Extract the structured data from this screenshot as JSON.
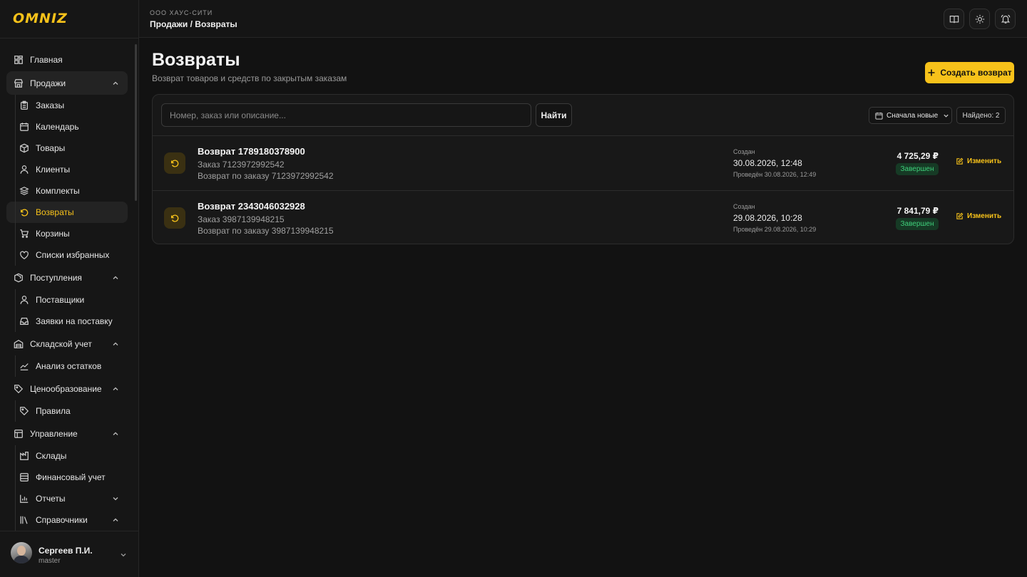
{
  "app": {
    "logo": "OMNIZ"
  },
  "header": {
    "org": "ООО ХАУС-СИТИ",
    "breadcrumb": "Продажи / Возвраты"
  },
  "sidebar": {
    "items": [
      {
        "label": "Главная",
        "icon": "dashboard-icon"
      },
      {
        "label": "Продажи",
        "icon": "store-icon",
        "expanded": true
      },
      {
        "label": "Заказы",
        "icon": "clipboard-icon"
      },
      {
        "label": "Календарь",
        "icon": "calendar-icon"
      },
      {
        "label": "Товары",
        "icon": "box-icon"
      },
      {
        "label": "Клиенты",
        "icon": "user-icon"
      },
      {
        "label": "Комплекты",
        "icon": "layers-icon"
      },
      {
        "label": "Возвраты",
        "icon": "return-icon",
        "active": true
      },
      {
        "label": "Корзины",
        "icon": "cart-icon"
      },
      {
        "label": "Списки избранных",
        "icon": "heart-icon"
      },
      {
        "label": "Поступления",
        "icon": "package-icon",
        "expanded": true
      },
      {
        "label": "Поставщики",
        "icon": "user-icon"
      },
      {
        "label": "Заявки на поставку",
        "icon": "inbox-icon"
      },
      {
        "label": "Складской учет",
        "icon": "warehouse-icon",
        "expanded": true
      },
      {
        "label": "Анализ остатков",
        "icon": "chart-icon"
      },
      {
        "label": "Ценообразование",
        "icon": "tag-icon",
        "expanded": true
      },
      {
        "label": "Правила",
        "icon": "tag-icon"
      },
      {
        "label": "Управление",
        "icon": "layout-icon",
        "expanded": true
      },
      {
        "label": "Склады",
        "icon": "warehouse-icon"
      },
      {
        "label": "Финансовый учет",
        "icon": "finance-icon"
      },
      {
        "label": "Отчеты",
        "icon": "bar-chart-icon",
        "expanded": false
      },
      {
        "label": "Справочники",
        "icon": "library-icon",
        "expanded": true
      }
    ]
  },
  "user": {
    "name": "Сергеев П.И.",
    "role": "master"
  },
  "page": {
    "title": "Возвраты",
    "subtitle": "Возврат товаров и средств по закрытым заказам",
    "create_label": "Создать возврат"
  },
  "search": {
    "placeholder": "Номер, заказ или описание...",
    "value": "",
    "button": "Найти"
  },
  "sort": {
    "selected": "Сначала новые"
  },
  "found_label": "Найдено: 2",
  "returns": [
    {
      "title": "Возврат 1789180378900",
      "order": "Заказ 7123972992542",
      "description": "Возврат по заказу 7123972992542",
      "created_label": "Создан",
      "created": "30.08.2026, 12:48",
      "posted": "Проведён 30.08.2026, 12:49",
      "amount": "4 725,29 ₽",
      "status": "Завершен",
      "edit_label": "Изменить"
    },
    {
      "title": "Возврат 2343046032928",
      "order": "Заказ 3987139948215",
      "description": "Возврат по заказу 3987139948215",
      "created_label": "Создан",
      "created": "29.08.2026, 10:28",
      "posted": "Проведён 29.08.2026, 10:29",
      "amount": "7 841,79 ₽",
      "status": "Завершен",
      "edit_label": "Изменить"
    }
  ],
  "colors": {
    "accent": "#f7c21a",
    "status_done_bg": "#163a25",
    "status_done_text": "#3fcf7a",
    "background": "#121212"
  }
}
